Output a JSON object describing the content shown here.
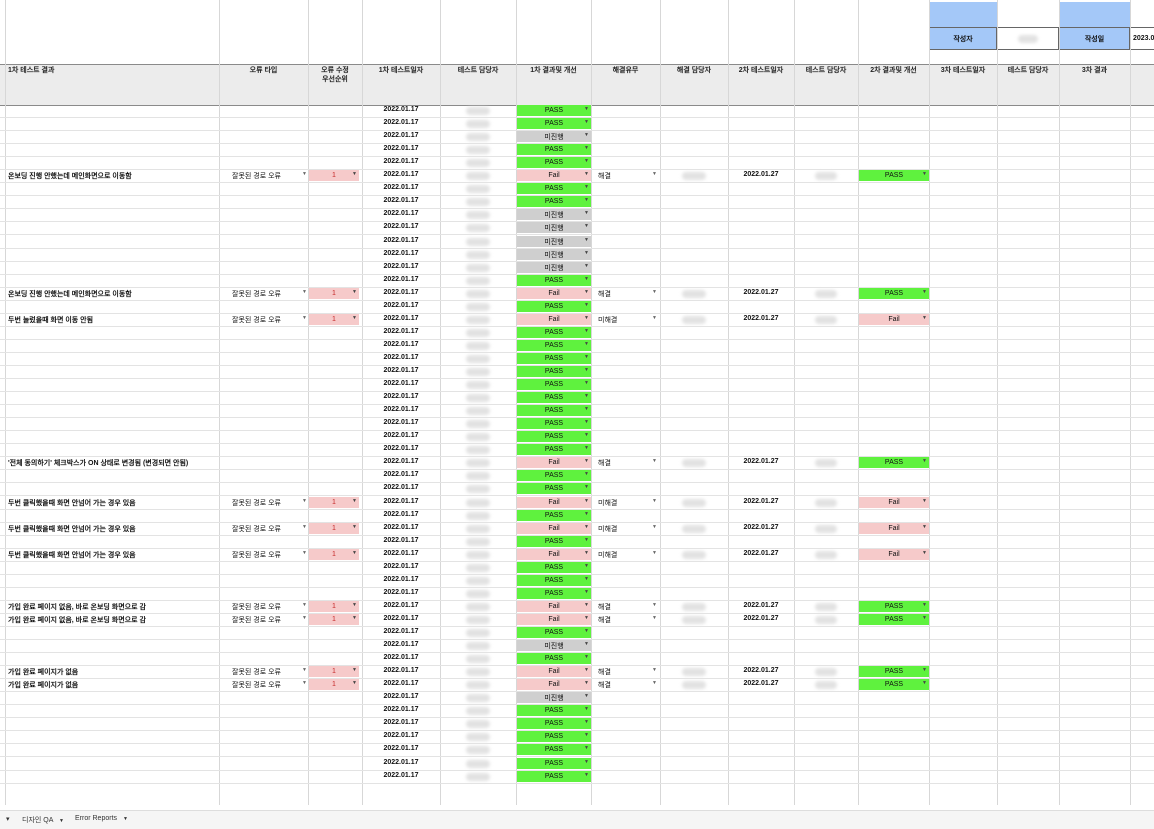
{
  "meta": {
    "author_label": "작성자",
    "date_label": "작성일",
    "date_value": "2023.0"
  },
  "headers": {
    "issue": "1차 테스트 결과",
    "error_type": "오류 타입",
    "priority_l1": "오류 수정",
    "priority_l2": "우선순위",
    "date1": "1차 테스트일자",
    "tester1": "테스트 담당자",
    "result1": "1차 결과및 개선",
    "resolved": "해결유무",
    "resolver": "해결 담당자",
    "date2": "2차 테스트일자",
    "tester2": "테스트 담당자",
    "result2": "2차 결과및 개선",
    "date3": "3차 테스트일자",
    "tester3": "테스트 담당자",
    "result3": "3차 결과"
  },
  "rows": [
    {
      "issue": "",
      "type": "",
      "prio": "",
      "date1": "2022.01.17",
      "r1": "PASS",
      "res": "",
      "date2": "",
      "r2": ""
    },
    {
      "issue": "",
      "type": "",
      "prio": "",
      "date1": "2022.01.17",
      "r1": "PASS",
      "res": "",
      "date2": "",
      "r2": ""
    },
    {
      "issue": "",
      "type": "",
      "prio": "",
      "date1": "2022.01.17",
      "r1": "미진행",
      "res": "",
      "date2": "",
      "r2": ""
    },
    {
      "issue": "",
      "type": "",
      "prio": "",
      "date1": "2022.01.17",
      "r1": "PASS",
      "res": "",
      "date2": "",
      "r2": ""
    },
    {
      "issue": "",
      "type": "",
      "prio": "",
      "date1": "2022.01.17",
      "r1": "PASS",
      "res": "",
      "date2": "",
      "r2": ""
    },
    {
      "issue": "온보딩 진행 안했는데 메인화면으로 이동함",
      "type": "잘못된 경로 오류",
      "prio": "1",
      "date1": "2022.01.17",
      "r1": "Fail",
      "res": "해결",
      "date2": "2022.01.27",
      "r2": "PASS"
    },
    {
      "issue": "",
      "type": "",
      "prio": "",
      "date1": "2022.01.17",
      "r1": "PASS",
      "res": "",
      "date2": "",
      "r2": ""
    },
    {
      "issue": "",
      "type": "",
      "prio": "",
      "date1": "2022.01.17",
      "r1": "PASS",
      "res": "",
      "date2": "",
      "r2": ""
    },
    {
      "issue": "",
      "type": "",
      "prio": "",
      "date1": "2022.01.17",
      "r1": "미진행",
      "res": "",
      "date2": "",
      "r2": ""
    },
    {
      "issue": "",
      "type": "",
      "prio": "",
      "date1": "2022.01.17",
      "r1": "미진행",
      "res": "",
      "date2": "",
      "r2": ""
    },
    {
      "issue": "",
      "type": "",
      "prio": "",
      "date1": "2022.01.17",
      "r1": "미진행",
      "res": "",
      "date2": "",
      "r2": ""
    },
    {
      "issue": "",
      "type": "",
      "prio": "",
      "date1": "2022.01.17",
      "r1": "미진행",
      "res": "",
      "date2": "",
      "r2": ""
    },
    {
      "issue": "",
      "type": "",
      "prio": "",
      "date1": "2022.01.17",
      "r1": "미진행",
      "res": "",
      "date2": "",
      "r2": ""
    },
    {
      "issue": "",
      "type": "",
      "prio": "",
      "date1": "2022.01.17",
      "r1": "PASS",
      "res": "",
      "date2": "",
      "r2": ""
    },
    {
      "issue": "온보딩 진행 안했는데 메인화면으로 이동함",
      "type": "잘못된 경로 오류",
      "prio": "1",
      "date1": "2022.01.17",
      "r1": "Fail",
      "res": "해결",
      "date2": "2022.01.27",
      "r2": "PASS"
    },
    {
      "issue": "",
      "type": "",
      "prio": "",
      "date1": "2022.01.17",
      "r1": "PASS",
      "res": "",
      "date2": "",
      "r2": ""
    },
    {
      "issue": "두번 눌렀을때 화면 이동 안됨",
      "type": "잘못된 경로 오류",
      "prio": "1",
      "date1": "2022.01.17",
      "r1": "Fail",
      "res": "미해결",
      "date2": "2022.01.27",
      "r2": "Fail"
    },
    {
      "issue": "",
      "type": "",
      "prio": "",
      "date1": "2022.01.17",
      "r1": "PASS",
      "res": "",
      "date2": "",
      "r2": ""
    },
    {
      "issue": "",
      "type": "",
      "prio": "",
      "date1": "2022.01.17",
      "r1": "PASS",
      "res": "",
      "date2": "",
      "r2": ""
    },
    {
      "issue": "",
      "type": "",
      "prio": "",
      "date1": "2022.01.17",
      "r1": "PASS",
      "res": "",
      "date2": "",
      "r2": ""
    },
    {
      "issue": "",
      "type": "",
      "prio": "",
      "date1": "2022.01.17",
      "r1": "PASS",
      "res": "",
      "date2": "",
      "r2": ""
    },
    {
      "issue": "",
      "type": "",
      "prio": "",
      "date1": "2022.01.17",
      "r1": "PASS",
      "res": "",
      "date2": "",
      "r2": ""
    },
    {
      "issue": "",
      "type": "",
      "prio": "",
      "date1": "2022.01.17",
      "r1": "PASS",
      "res": "",
      "date2": "",
      "r2": ""
    },
    {
      "issue": "",
      "type": "",
      "prio": "",
      "date1": "2022.01.17",
      "r1": "PASS",
      "res": "",
      "date2": "",
      "r2": ""
    },
    {
      "issue": "",
      "type": "",
      "prio": "",
      "date1": "2022.01.17",
      "r1": "PASS",
      "res": "",
      "date2": "",
      "r2": ""
    },
    {
      "issue": "",
      "type": "",
      "prio": "",
      "date1": "2022.01.17",
      "r1": "PASS",
      "res": "",
      "date2": "",
      "r2": ""
    },
    {
      "issue": "",
      "type": "",
      "prio": "",
      "date1": "2022.01.17",
      "r1": "PASS",
      "res": "",
      "date2": "",
      "r2": ""
    },
    {
      "issue": "'전체 동의하기' 체크박스가 ON 상태로 변경됨 (변경되면 안됨)",
      "type": "",
      "prio": "",
      "date1": "2022.01.17",
      "r1": "Fail",
      "res": "해결",
      "date2": "2022.01.27",
      "r2": "PASS"
    },
    {
      "issue": "",
      "type": "",
      "prio": "",
      "date1": "2022.01.17",
      "r1": "PASS",
      "res": "",
      "date2": "",
      "r2": ""
    },
    {
      "issue": "",
      "type": "",
      "prio": "",
      "date1": "2022.01.17",
      "r1": "PASS",
      "res": "",
      "date2": "",
      "r2": ""
    },
    {
      "issue": "두번 클릭했을때 화면 안넘어 가는 경우 있음",
      "type": "잘못된 경로 오류",
      "prio": "1",
      "date1": "2022.01.17",
      "r1": "Fail",
      "res": "미해결",
      "date2": "2022.01.27",
      "r2": "Fail"
    },
    {
      "issue": "",
      "type": "",
      "prio": "",
      "date1": "2022.01.17",
      "r1": "PASS",
      "res": "",
      "date2": "",
      "r2": ""
    },
    {
      "issue": "두번 클릭했을때 화면 안넘어 가는 경우 있음",
      "type": "잘못된 경로 오류",
      "prio": "1",
      "date1": "2022.01.17",
      "r1": "Fail",
      "res": "미해결",
      "date2": "2022.01.27",
      "r2": "Fail"
    },
    {
      "issue": "",
      "type": "",
      "prio": "",
      "date1": "2022.01.17",
      "r1": "PASS",
      "res": "",
      "date2": "",
      "r2": ""
    },
    {
      "issue": "두번 클릭했을때 화면 안넘어 가는 경우 있음",
      "type": "잘못된 경로 오류",
      "prio": "1",
      "date1": "2022.01.17",
      "r1": "Fail",
      "res": "미해결",
      "date2": "2022.01.27",
      "r2": "Fail"
    },
    {
      "issue": "",
      "type": "",
      "prio": "",
      "date1": "2022.01.17",
      "r1": "PASS",
      "res": "",
      "date2": "",
      "r2": ""
    },
    {
      "issue": "",
      "type": "",
      "prio": "",
      "date1": "2022.01.17",
      "r1": "PASS",
      "res": "",
      "date2": "",
      "r2": ""
    },
    {
      "issue": "",
      "type": "",
      "prio": "",
      "date1": "2022.01.17",
      "r1": "PASS",
      "res": "",
      "date2": "",
      "r2": ""
    },
    {
      "issue": "가입 완료 페이지 없음, 바로 온보딩 화면으로 감",
      "type": "잘못된 경로 오류",
      "prio": "1",
      "date1": "2022.01.17",
      "r1": "Fail",
      "res": "해결",
      "date2": "2022.01.27",
      "r2": "PASS"
    },
    {
      "issue": "가입 완료 페이지 없음, 바로 온보딩 화면으로 감",
      "type": "잘못된 경로 오류",
      "prio": "1",
      "date1": "2022.01.17",
      "r1": "Fail",
      "res": "해결",
      "date2": "2022.01.27",
      "r2": "PASS"
    },
    {
      "issue": "",
      "type": "",
      "prio": "",
      "date1": "2022.01.17",
      "r1": "PASS",
      "res": "",
      "date2": "",
      "r2": ""
    },
    {
      "issue": "",
      "type": "",
      "prio": "",
      "date1": "2022.01.17",
      "r1": "미진행",
      "res": "",
      "date2": "",
      "r2": ""
    },
    {
      "issue": "",
      "type": "",
      "prio": "",
      "date1": "2022.01.17",
      "r1": "PASS",
      "res": "",
      "date2": "",
      "r2": ""
    },
    {
      "issue": "가입 완료 페이지가 없음",
      "type": "잘못된 경로 오류",
      "prio": "1",
      "date1": "2022.01.17",
      "r1": "Fail",
      "res": "해결",
      "date2": "2022.01.27",
      "r2": "PASS"
    },
    {
      "issue": "가입 완료 페이지가 없음",
      "type": "잘못된 경로 오류",
      "prio": "1",
      "date1": "2022.01.17",
      "r1": "Fail",
      "res": "해결",
      "date2": "2022.01.27",
      "r2": "PASS"
    },
    {
      "issue": "",
      "type": "",
      "prio": "",
      "date1": "2022.01.17",
      "r1": "미진행",
      "res": "",
      "date2": "",
      "r2": ""
    },
    {
      "issue": "",
      "type": "",
      "prio": "",
      "date1": "2022.01.17",
      "r1": "PASS",
      "res": "",
      "date2": "",
      "r2": ""
    },
    {
      "issue": "",
      "type": "",
      "prio": "",
      "date1": "2022.01.17",
      "r1": "PASS",
      "res": "",
      "date2": "",
      "r2": ""
    },
    {
      "issue": "",
      "type": "",
      "prio": "",
      "date1": "2022.01.17",
      "r1": "PASS",
      "res": "",
      "date2": "",
      "r2": ""
    },
    {
      "issue": "",
      "type": "",
      "prio": "",
      "date1": "2022.01.17",
      "r1": "PASS",
      "res": "",
      "date2": "",
      "r2": ""
    },
    {
      "issue": "",
      "type": "",
      "prio": "",
      "date1": "2022.01.17",
      "r1": "PASS",
      "res": "",
      "date2": "",
      "r2": ""
    },
    {
      "issue": "",
      "type": "",
      "prio": "",
      "date1": "2022.01.17",
      "r1": "PASS",
      "res": "",
      "date2": "",
      "r2": ""
    }
  ],
  "tabs": [
    {
      "label": "디자인 QA"
    },
    {
      "label": "Error Reports"
    }
  ],
  "colors": {
    "pass": "#5ff23e",
    "fail": "#f6caca",
    "pending": "#cfcfcf",
    "meta_header": "#a4c8f8"
  }
}
